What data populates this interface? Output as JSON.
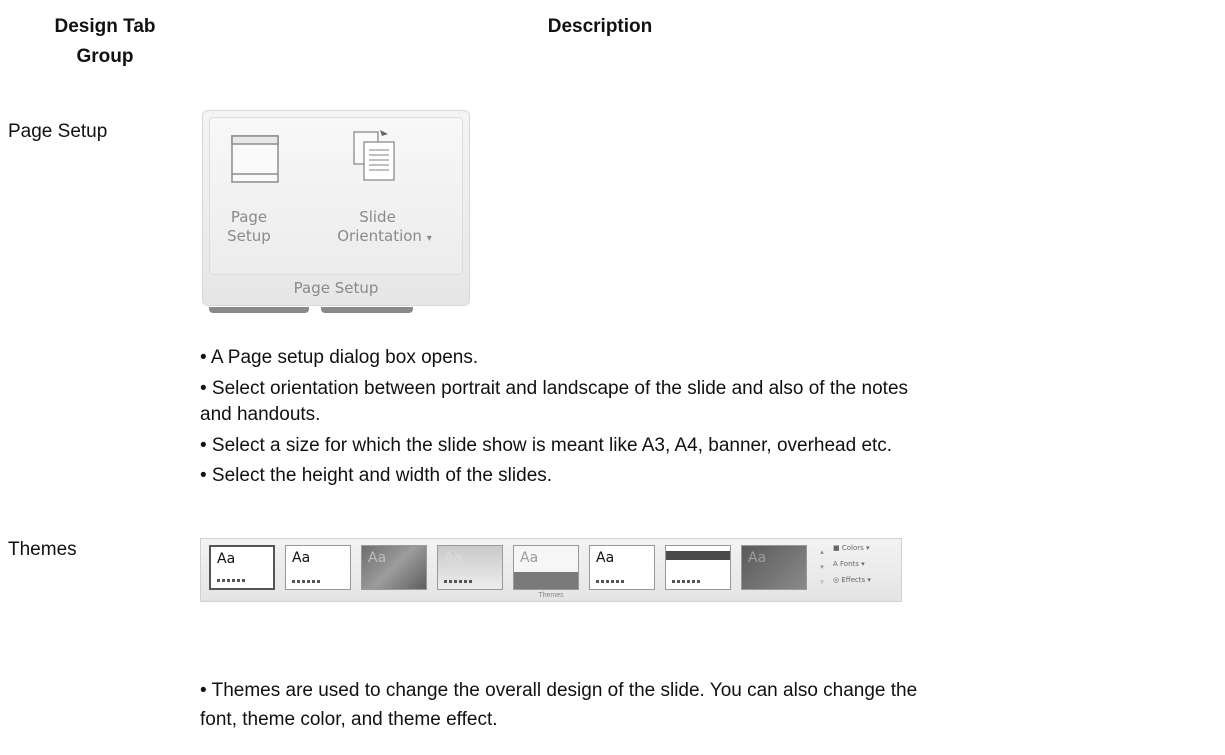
{
  "table": {
    "header_group_line1": "Design Tab",
    "header_group_line2": "Group",
    "header_description": "Description"
  },
  "rows": [
    {
      "group": "Page Setup",
      "ribbon": {
        "button1_line1": "Page",
        "button1_line2": "Setup",
        "button2_line1": "Slide",
        "button2_line2": "Orientation",
        "footer": "Page Setup"
      },
      "bullets": [
        "• A Page setup dialog box opens.",
        "• Select orientation between portrait and landscape of the slide and also of the notes",
        "and handouts.",
        "• Select a size for which the slide show is meant like A3, A4, banner, overhead etc.",
        "• Select the height and width of the slides."
      ]
    },
    {
      "group": "Themes",
      "ribbon": {
        "thumb_label": "Aa",
        "side_colors": "Colors",
        "side_fonts": "Fonts",
        "side_effects": "Effects",
        "footer": "Themes"
      },
      "bullets": [
        "• Themes are used to change the overall design of the slide. You can also change the",
        "font, theme color, and theme effect."
      ]
    }
  ],
  "icons": [
    "page-setup-icon",
    "slide-orientation-icon",
    "dropdown-arrow-icon",
    "colors-icon",
    "fonts-icon",
    "effects-icon"
  ]
}
